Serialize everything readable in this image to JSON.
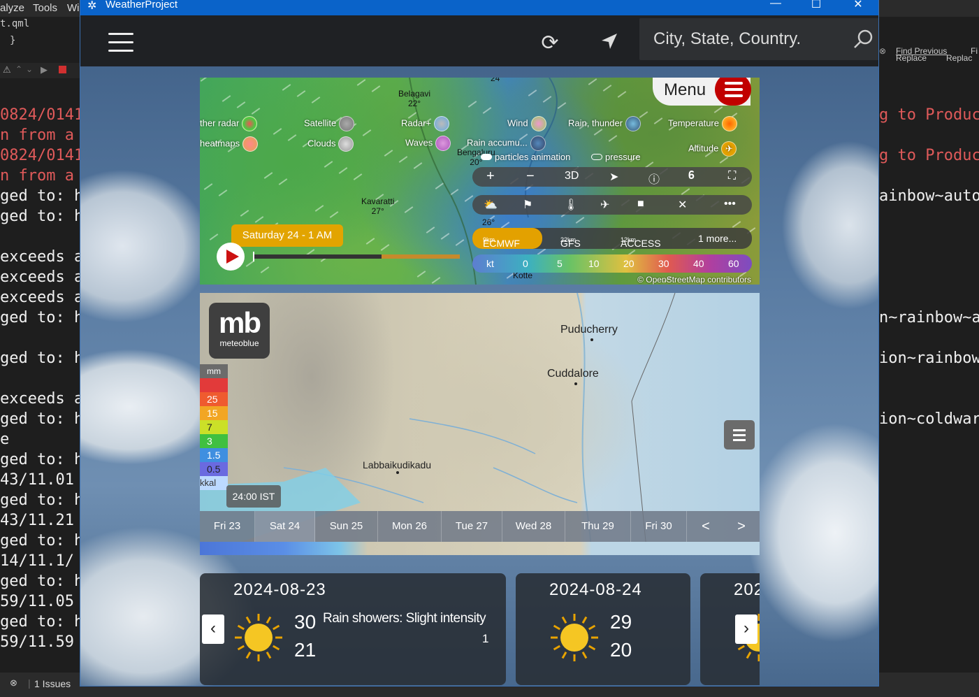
{
  "ide": {
    "menu": [
      "alyze",
      "Tools",
      "Wi"
    ],
    "file": "t.qml",
    "brace": "}",
    "left_lines": [
      {
        "text": "0824/0141",
        "red": true
      },
      {
        "text": "n from a",
        "red": true
      },
      {
        "text": "0824/0141",
        "red": true
      },
      {
        "text": "n from a",
        "red": true
      },
      {
        "text": "ged to: h",
        "red": false
      },
      {
        "text": "ged to: h",
        "red": false
      },
      {
        "text": "",
        "red": false
      },
      {
        "text": "exceeds a",
        "red": false
      },
      {
        "text": "exceeds a",
        "red": false
      },
      {
        "text": "exceeds a",
        "red": false
      },
      {
        "text": "ged to: h",
        "red": false
      },
      {
        "text": "",
        "red": false
      },
      {
        "text": "ged to: h",
        "red": false
      },
      {
        "text": "",
        "red": false
      },
      {
        "text": "exceeds a",
        "red": false
      },
      {
        "text": "ged to: h",
        "red": false
      },
      {
        "text": "e",
        "red": false
      },
      {
        "text": "ged to: h",
        "red": false
      },
      {
        "text": "43/11.01",
        "red": false
      },
      {
        "text": "ged to: h",
        "red": false
      },
      {
        "text": "43/11.21",
        "red": false
      },
      {
        "text": "ged to: h",
        "red": false
      },
      {
        "text": "14/11.1/",
        "red": false
      },
      {
        "text": "ged to: h",
        "red": false
      },
      {
        "text": "59/11.05",
        "red": false
      },
      {
        "text": "ged to: h",
        "red": false
      },
      {
        "text": "59/11.59",
        "red": false
      }
    ],
    "right_lines": [
      {
        "text": "g to Produc",
        "red": true
      },
      {
        "text": "",
        "red": false
      },
      {
        "text": "g to Produc",
        "red": true
      },
      {
        "text": "",
        "red": false
      },
      {
        "text": "ainbow~auto",
        "red": false
      },
      {
        "text": "",
        "red": false
      },
      {
        "text": "",
        "red": false
      },
      {
        "text": "",
        "red": false
      },
      {
        "text": "",
        "red": false
      },
      {
        "text": "",
        "red": false
      },
      {
        "text": "n~rainbow~a",
        "red": false
      },
      {
        "text": "",
        "red": false
      },
      {
        "text": "ion~rainbow",
        "red": false
      },
      {
        "text": "",
        "red": false
      },
      {
        "text": "",
        "red": false
      },
      {
        "text": "ion~coldwar",
        "red": false
      }
    ],
    "find_previous": "Find Previous",
    "find_next_abbrev": "Fi",
    "replace": "Replace",
    "replace2": "Replac",
    "status": "1 Issues"
  },
  "window": {
    "title": "WeatherProject"
  },
  "app": {
    "search_placeholder": "City, State, Country."
  },
  "windy": {
    "menu_label": "Menu",
    "layers": {
      "radar": "ther radar",
      "heatmaps": "heatmaps",
      "satellite": "Satellite",
      "clouds": "Clouds",
      "radar_plus": "Radar+",
      "waves": "Waves",
      "wind": "Wind",
      "rain_thunder": "Rain, thunder",
      "temperature": "Temperature",
      "rain_accum": "Rain accumu...",
      "altitude": "Altitude",
      "particles": "particles animation",
      "pressure": "pressure"
    },
    "cities": {
      "belagavi": "Belagavi",
      "belagavi_t": "22°",
      "bengaluru": "Bengaluru",
      "bengaluru_t": "20°",
      "kavaratti": "Kavaratti",
      "kavaratti_t": "27°",
      "kotte": "Kotte",
      "top_t": "24",
      "side_t": "26°"
    },
    "controls_zoom": [
      "+",
      "−",
      "3D"
    ],
    "time_label": "Saturday 24 - 1 AM",
    "models": [
      {
        "name": "ECMWF",
        "res": "9km"
      },
      {
        "name": "GFS",
        "res": "22km"
      },
      {
        "name": "ACCESS",
        "res": "12km"
      },
      {
        "name": "1 more...",
        "res": ""
      }
    ],
    "scale": [
      "kt",
      "0",
      "5",
      "10",
      "20",
      "30",
      "40",
      "60"
    ],
    "attribution": "© OpenStreetMap contributors",
    "timeline_progress": 0.62
  },
  "meteoblue": {
    "logo_big": "mb",
    "logo_small": "meteoblue",
    "legend": [
      "mm",
      "",
      "25",
      "15",
      "7",
      "3",
      "1.5",
      "0.5"
    ],
    "cities": {
      "puducherry": "Puducherry",
      "cuddalore": "Cuddalore",
      "labbaikudikadu": "Labbaikudikadu",
      "kkal": "kkal"
    },
    "time_label": "24:00 IST",
    "days": [
      "Fri 23",
      "Sat 24",
      "Sun 25",
      "Mon 26",
      "Tue 27",
      "Wed 28",
      "Thu 29",
      "Fri 30"
    ],
    "selected_day": 1,
    "prev": "<",
    "next": ">"
  },
  "forecast": {
    "cards": [
      {
        "date": "2024-08-23",
        "hi": "30",
        "lo": "21",
        "condition": "Rain showers: Slight intensity",
        "pop": "1",
        "icon": "sun-icon"
      },
      {
        "date": "2024-08-24",
        "hi": "29",
        "lo": "20",
        "condition": "",
        "pop": "",
        "icon": "sun-icon"
      },
      {
        "date": "202",
        "hi": "",
        "lo": "",
        "condition": "",
        "pop": "",
        "icon": "sun-icon"
      }
    ],
    "prev": "‹",
    "next": "›"
  },
  "colors": {
    "titlebar": "#0a63c9",
    "windy_accent": "#e3a100",
    "windy_menu_red": "#c10000"
  }
}
